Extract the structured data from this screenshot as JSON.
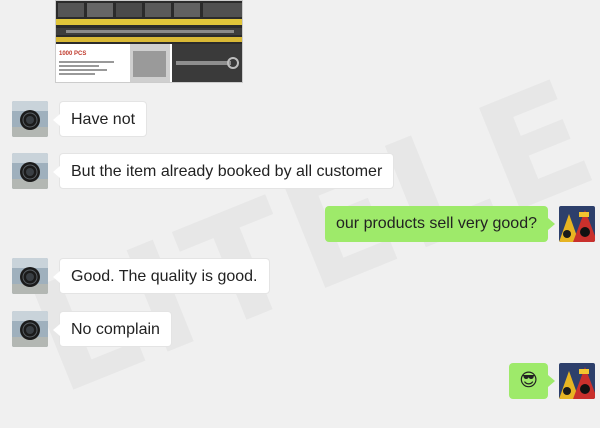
{
  "watermark": "LITELE",
  "product_image": {
    "label": "1000 PCS"
  },
  "messages": [
    {
      "side": "left",
      "text": "Have not"
    },
    {
      "side": "left",
      "text": "But the item already booked by all customer"
    },
    {
      "side": "right",
      "text": "our products sell very good?"
    },
    {
      "side": "left",
      "text": "Good. The quality is good."
    },
    {
      "side": "left",
      "text": "No complain"
    },
    {
      "side": "right",
      "text": "😎"
    }
  ],
  "colors": {
    "background": "#f0f0f0",
    "incoming_bubble": "#ffffff",
    "outgoing_bubble": "#9eea6a"
  }
}
